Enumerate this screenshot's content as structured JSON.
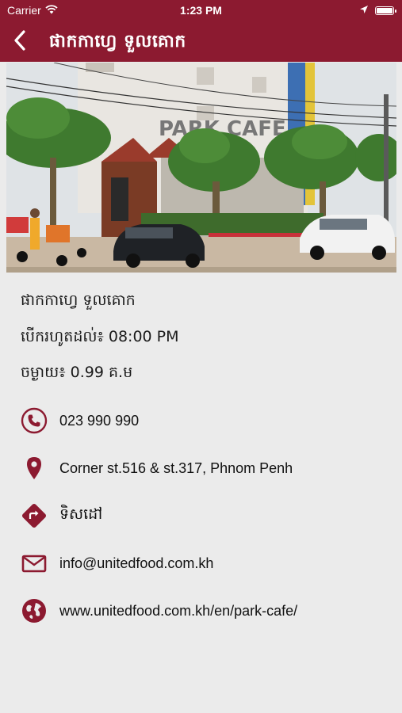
{
  "status_bar": {
    "carrier": "Carrier",
    "time": "1:23 PM",
    "battery_level": 1.0
  },
  "nav": {
    "title": "ផាកកាហ្វេ ទួលគោក",
    "back_icon": "chevron-left-icon"
  },
  "hero_image": {
    "sign_text": "PARK CAFE"
  },
  "details": {
    "name": "ផាកកាហ្វេ ទួលគោក",
    "hours": "បើករហូតដល់៖ 08:00 PM",
    "distance": "ចម្ងាយ៖ 0.99 គ.ម"
  },
  "contacts": [
    {
      "icon": "phone-icon",
      "text": "023 990 990"
    },
    {
      "icon": "location-pin-icon",
      "text": "Corner st.516 & st.317, Phnom Penh"
    },
    {
      "icon": "directions-icon",
      "text": "ទិសដៅ"
    },
    {
      "icon": "mail-icon",
      "text": "info@unitedfood.com.kh"
    },
    {
      "icon": "globe-icon",
      "text": "www.unitedfood.com.kh/en/park-cafe/"
    }
  ],
  "colors": {
    "brand": "#8c1a30",
    "background": "#ebebeb"
  }
}
